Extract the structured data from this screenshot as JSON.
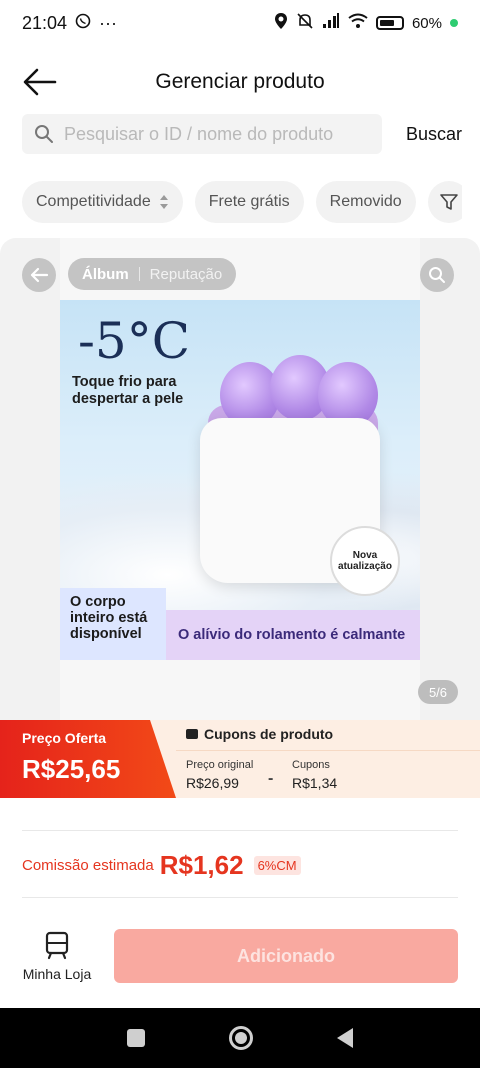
{
  "status_bar": {
    "time": "21:04",
    "extra": "···",
    "battery": "60%",
    "icons": [
      "whatsapp-icon",
      "location-icon",
      "mute-icon",
      "signal-icon",
      "wifi-icon",
      "battery-icon"
    ]
  },
  "header": {
    "title": "Gerenciar produto",
    "back_icon": "arrow-left-icon"
  },
  "search": {
    "placeholder": "Pesquisar o ID / nome do produto",
    "value": "",
    "button": "Buscar"
  },
  "filters": {
    "chips": [
      "Competitividade",
      "Frete grátis",
      "Removido"
    ],
    "filter_icon": "funnel-icon"
  },
  "media": {
    "tabs": {
      "active": "Álbum",
      "other": "Reputação"
    },
    "page_indicator": "5/6",
    "image_texts": {
      "temperature": "-5°C",
      "caption": "Toque frio para despertar a pele",
      "badge": "Nova atualização",
      "bottom_left": "O corpo inteiro está disponível",
      "bottom_right": "O alívio do rolamento é calmante"
    }
  },
  "price": {
    "offer_label": "Preço Oferta",
    "offer_value": "R$25,65",
    "coupons_title": "Cupons de produto",
    "original_label": "Preço original",
    "original_value": "R$26,99",
    "separator": "-",
    "coupon_label": "Cupons",
    "coupon_value": "R$1,34"
  },
  "commission": {
    "label": "Comissão estimada",
    "value": "R$1,62",
    "percent": "6%CM"
  },
  "actions": {
    "store_label": "Minha Loja",
    "add_button": "Adicionado"
  },
  "colors": {
    "accent_red": "#e5351f",
    "offer_gradient_start": "#e5231b",
    "button_disabled": "#f9a9a0"
  }
}
